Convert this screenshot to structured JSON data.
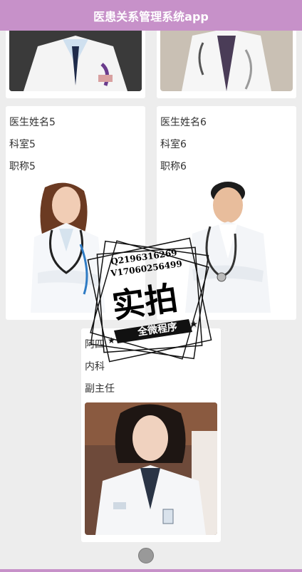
{
  "app_title": "医患关系管理系统app",
  "doctors": [
    {
      "name": "医生姓名5",
      "department": "科室5",
      "title": "职称5",
      "photo": "female-doctor-photo"
    },
    {
      "name": "医生姓名6",
      "department": "科室6",
      "title": "职称6",
      "photo": "male-doctor-photo"
    },
    {
      "name": "阿四",
      "department": "内科",
      "title": "副主任",
      "photo": "female-doctor-photo"
    }
  ],
  "watermark": {
    "qq": "Q2196316269",
    "wechat": "V17060256499",
    "main_text": "实拍",
    "ribbon_text": "全微程序"
  },
  "colors": {
    "accent": "#c791c9",
    "background": "#ededed"
  }
}
